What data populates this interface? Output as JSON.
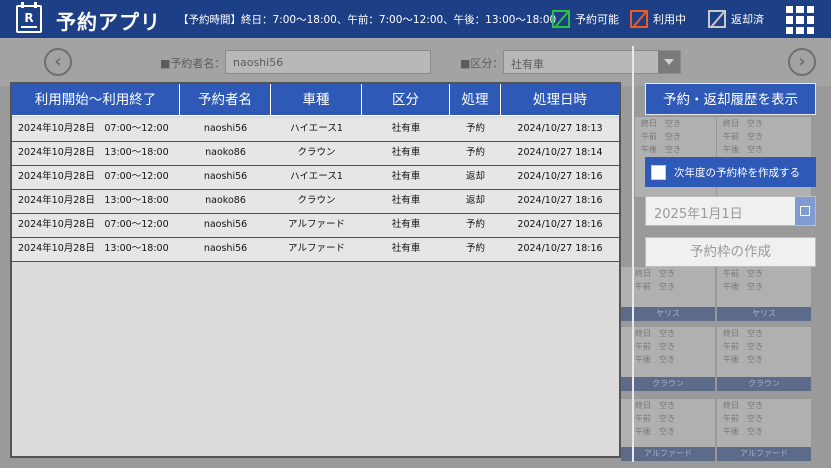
{
  "header": {
    "title": "予約アプリ",
    "hours": "【予約時間】終日：7:00～18:00、午前：7:00～12:00、午後：13:00～18:00",
    "legend": [
      {
        "key": "avail",
        "label": "予約可能",
        "color": "#2fbf45"
      },
      {
        "key": "use",
        "label": "利用中",
        "color": "#ee5a24"
      },
      {
        "key": "ret",
        "label": "返却済",
        "color": "#c9c9c9"
      }
    ]
  },
  "filters": {
    "user_label": "■予約者名：",
    "user_value": "naoshi56",
    "category_label": "■区分：",
    "category_value": "社有車"
  },
  "nav": {
    "prev": "‹",
    "next": "›"
  },
  "table": {
    "headers": [
      "利用開始～利用終了",
      "予約者名",
      "車種",
      "区分",
      "処理",
      "処理日時"
    ],
    "rows": [
      [
        "2024年10月28日　07:00～12:00",
        "naoshi56",
        "ハイエース1",
        "社有車",
        "予約",
        "2024/10/27 18:13"
      ],
      [
        "2024年10月28日　13:00～18:00",
        "naoko86",
        "クラウン",
        "社有車",
        "予約",
        "2024/10/27 18:14"
      ],
      [
        "2024年10月28日　07:00～12:00",
        "naoshi56",
        "ハイエース1",
        "社有車",
        "返却",
        "2024/10/27 18:16"
      ],
      [
        "2024年10月28日　13:00～18:00",
        "naoko86",
        "クラウン",
        "社有車",
        "返却",
        "2024/10/27 18:16"
      ],
      [
        "2024年10月28日　07:00～12:00",
        "naoshi56",
        "アルファード",
        "社有車",
        "予約",
        "2024/10/27 18:16"
      ],
      [
        "2024年10月28日　13:00～18:00",
        "naoshi56",
        "アルファード",
        "社有車",
        "予約",
        "2024/10/27 18:16"
      ]
    ]
  },
  "right": {
    "history_button": "予約・返却履歴を表示",
    "create_checkbox_label": "次年度の予約枠を作成する",
    "date_value": "2025年1月1日",
    "make_button": "予約枠の作成"
  },
  "background_calendar": {
    "rows": [
      "終日　空き",
      "午前　空き",
      "午後　空き"
    ],
    "cars": [
      "ヤリス",
      "ヤリス",
      "クラウン",
      "クラウン",
      "アルファード",
      "アルファード"
    ]
  }
}
